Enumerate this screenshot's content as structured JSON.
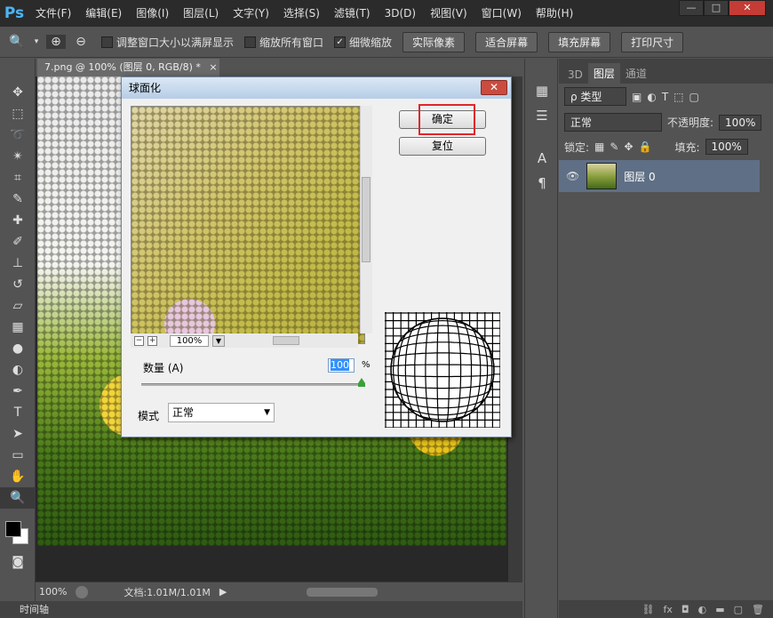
{
  "app": {
    "logo": "Ps"
  },
  "menu": [
    "文件(F)",
    "编辑(E)",
    "图像(I)",
    "图层(L)",
    "文字(Y)",
    "选择(S)",
    "滤镜(T)",
    "3D(D)",
    "视图(V)",
    "窗口(W)",
    "帮助(H)"
  ],
  "window_controls": {
    "minimize": "—",
    "restore": "□",
    "close": "✕"
  },
  "options": {
    "resize_windows": "调整窗口大小以满屏显示",
    "zoom_all": "缩放所有窗口",
    "scrubby_zoom": "细微缩放",
    "actual_pixels": "实际像素",
    "fit_screen": "适合屏幕",
    "fill_screen": "填充屏幕",
    "print_size": "打印尺寸"
  },
  "document": {
    "tab": "7.png @ 100% (图层 0, RGB/8) *",
    "close": "×"
  },
  "status": {
    "zoom": "100%",
    "doc_info": "文档:1.01M/1.01M",
    "timeline": "时间轴"
  },
  "dialog": {
    "title": "球面化",
    "close": "✕",
    "ok": "确定",
    "reset": "复位",
    "preview_zoom": "100%",
    "amount_label": "数量 (A)",
    "amount_value": "100",
    "amount_unit": "%",
    "mode_label": "模式",
    "mode_value": "正常"
  },
  "layers": {
    "tab_3d": "3D",
    "tab_layers": "图层",
    "tab_channels": "通道",
    "filter_kind": "ρ 类型",
    "blend_mode": "正常",
    "opacity_label": "不透明度:",
    "opacity_value": "100%",
    "lock_label": "锁定:",
    "fill_label": "填充:",
    "fill_value": "100%",
    "layer_name": "图层 0"
  },
  "accent": {
    "dialog_border": "#6b87a8",
    "ok_highlight": "#e0262b",
    "layer_selected": "#5f6f85"
  }
}
